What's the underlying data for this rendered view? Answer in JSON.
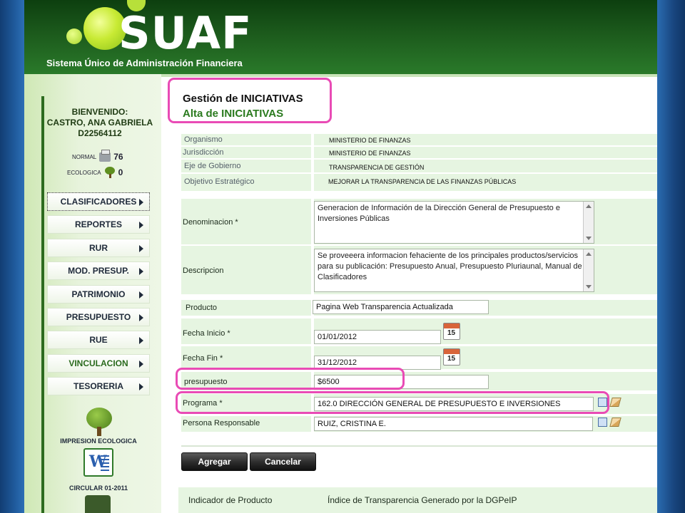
{
  "app": {
    "brand": "SUAF",
    "subtitle": "Sistema Único de Administración Financiera"
  },
  "user": {
    "welcome": "BIENVENIDO:",
    "name": "CASTRO, ANA GABRIELA",
    "id": "D22564112"
  },
  "counters": {
    "normal_label": "NORMAL",
    "normal_value": "76",
    "eco_label": "ECOLOGICA",
    "eco_value": "0"
  },
  "sidebar": {
    "items": [
      {
        "label": "CLASIFICADORES"
      },
      {
        "label": "REPORTES"
      },
      {
        "label": "RUR"
      },
      {
        "label": "MOD. PRESUP."
      },
      {
        "label": "PATRIMONIO"
      },
      {
        "label": "PRESUPUESTO"
      },
      {
        "label": "RUE"
      },
      {
        "label": "VINCULACION"
      },
      {
        "label": "TESORERIA"
      }
    ],
    "eco_print_label": "IMPRESION ECOLOGICA",
    "circular_label": "CIRCULAR 01-2011"
  },
  "page": {
    "title": "Gestión de INICIATIVAS",
    "subtitle": "Alta de INICIATIVAS"
  },
  "info": {
    "organismo_label": "Organismo",
    "organismo_value": "MINISTERIO DE FINANZAS",
    "jurisdiccion_label": "Jurisdicción",
    "jurisdiccion_value": "MINISTERIO DE FINANZAS",
    "eje_label": "Eje de Gobierno",
    "eje_value": "TRANSPARENCIA DE GESTIÓN",
    "objetivo_label": "Objetivo Estratégico",
    "objetivo_value": "MEJORAR LA TRANSPARENCIA DE LAS FINANZAS PÚBLICAS"
  },
  "form": {
    "denominacion_label": "Denominacion *",
    "denominacion_value": "Generacion de Información  de la Dirección General de Presupuesto e Inversiones Públicas",
    "descripcion_label": "Descripcion",
    "descripcion_value": "Se proveeera informacion fehaciente de los principales productos/servicios para su publicación: Presupuesto Anual, Presupuesto Pluriaunal, Manual de Clasificadores",
    "producto_label": "Producto",
    "producto_value": "Pagina Web Transparencia Actualizada",
    "fecha_inicio_label": "Fecha Inicio *",
    "fecha_inicio_value": "01/01/2012",
    "fecha_fin_label": "Fecha Fin *",
    "fecha_fin_value": "31/12/2012",
    "calendar_day": "15",
    "presupuesto_label": "presupuesto",
    "presupuesto_value": "$6500",
    "programa_label": "Programa *",
    "programa_value": "162.0  DIRECCIÓN GENERAL DE PRESUPUESTO E INVERSIONES",
    "responsable_label": "Persona Responsable",
    "responsable_value": "RUIZ, CRISTINA E."
  },
  "buttons": {
    "agregar": "Agregar",
    "cancelar": "Cancelar"
  },
  "indicador": {
    "label": "Indicador de Producto",
    "value": "Índice de Transparencia Generado por la DGPeIP"
  },
  "colors": {
    "highlight": "#e94bb5",
    "header_green": "#1c5a1c",
    "row_green": "#e6f5e1"
  }
}
